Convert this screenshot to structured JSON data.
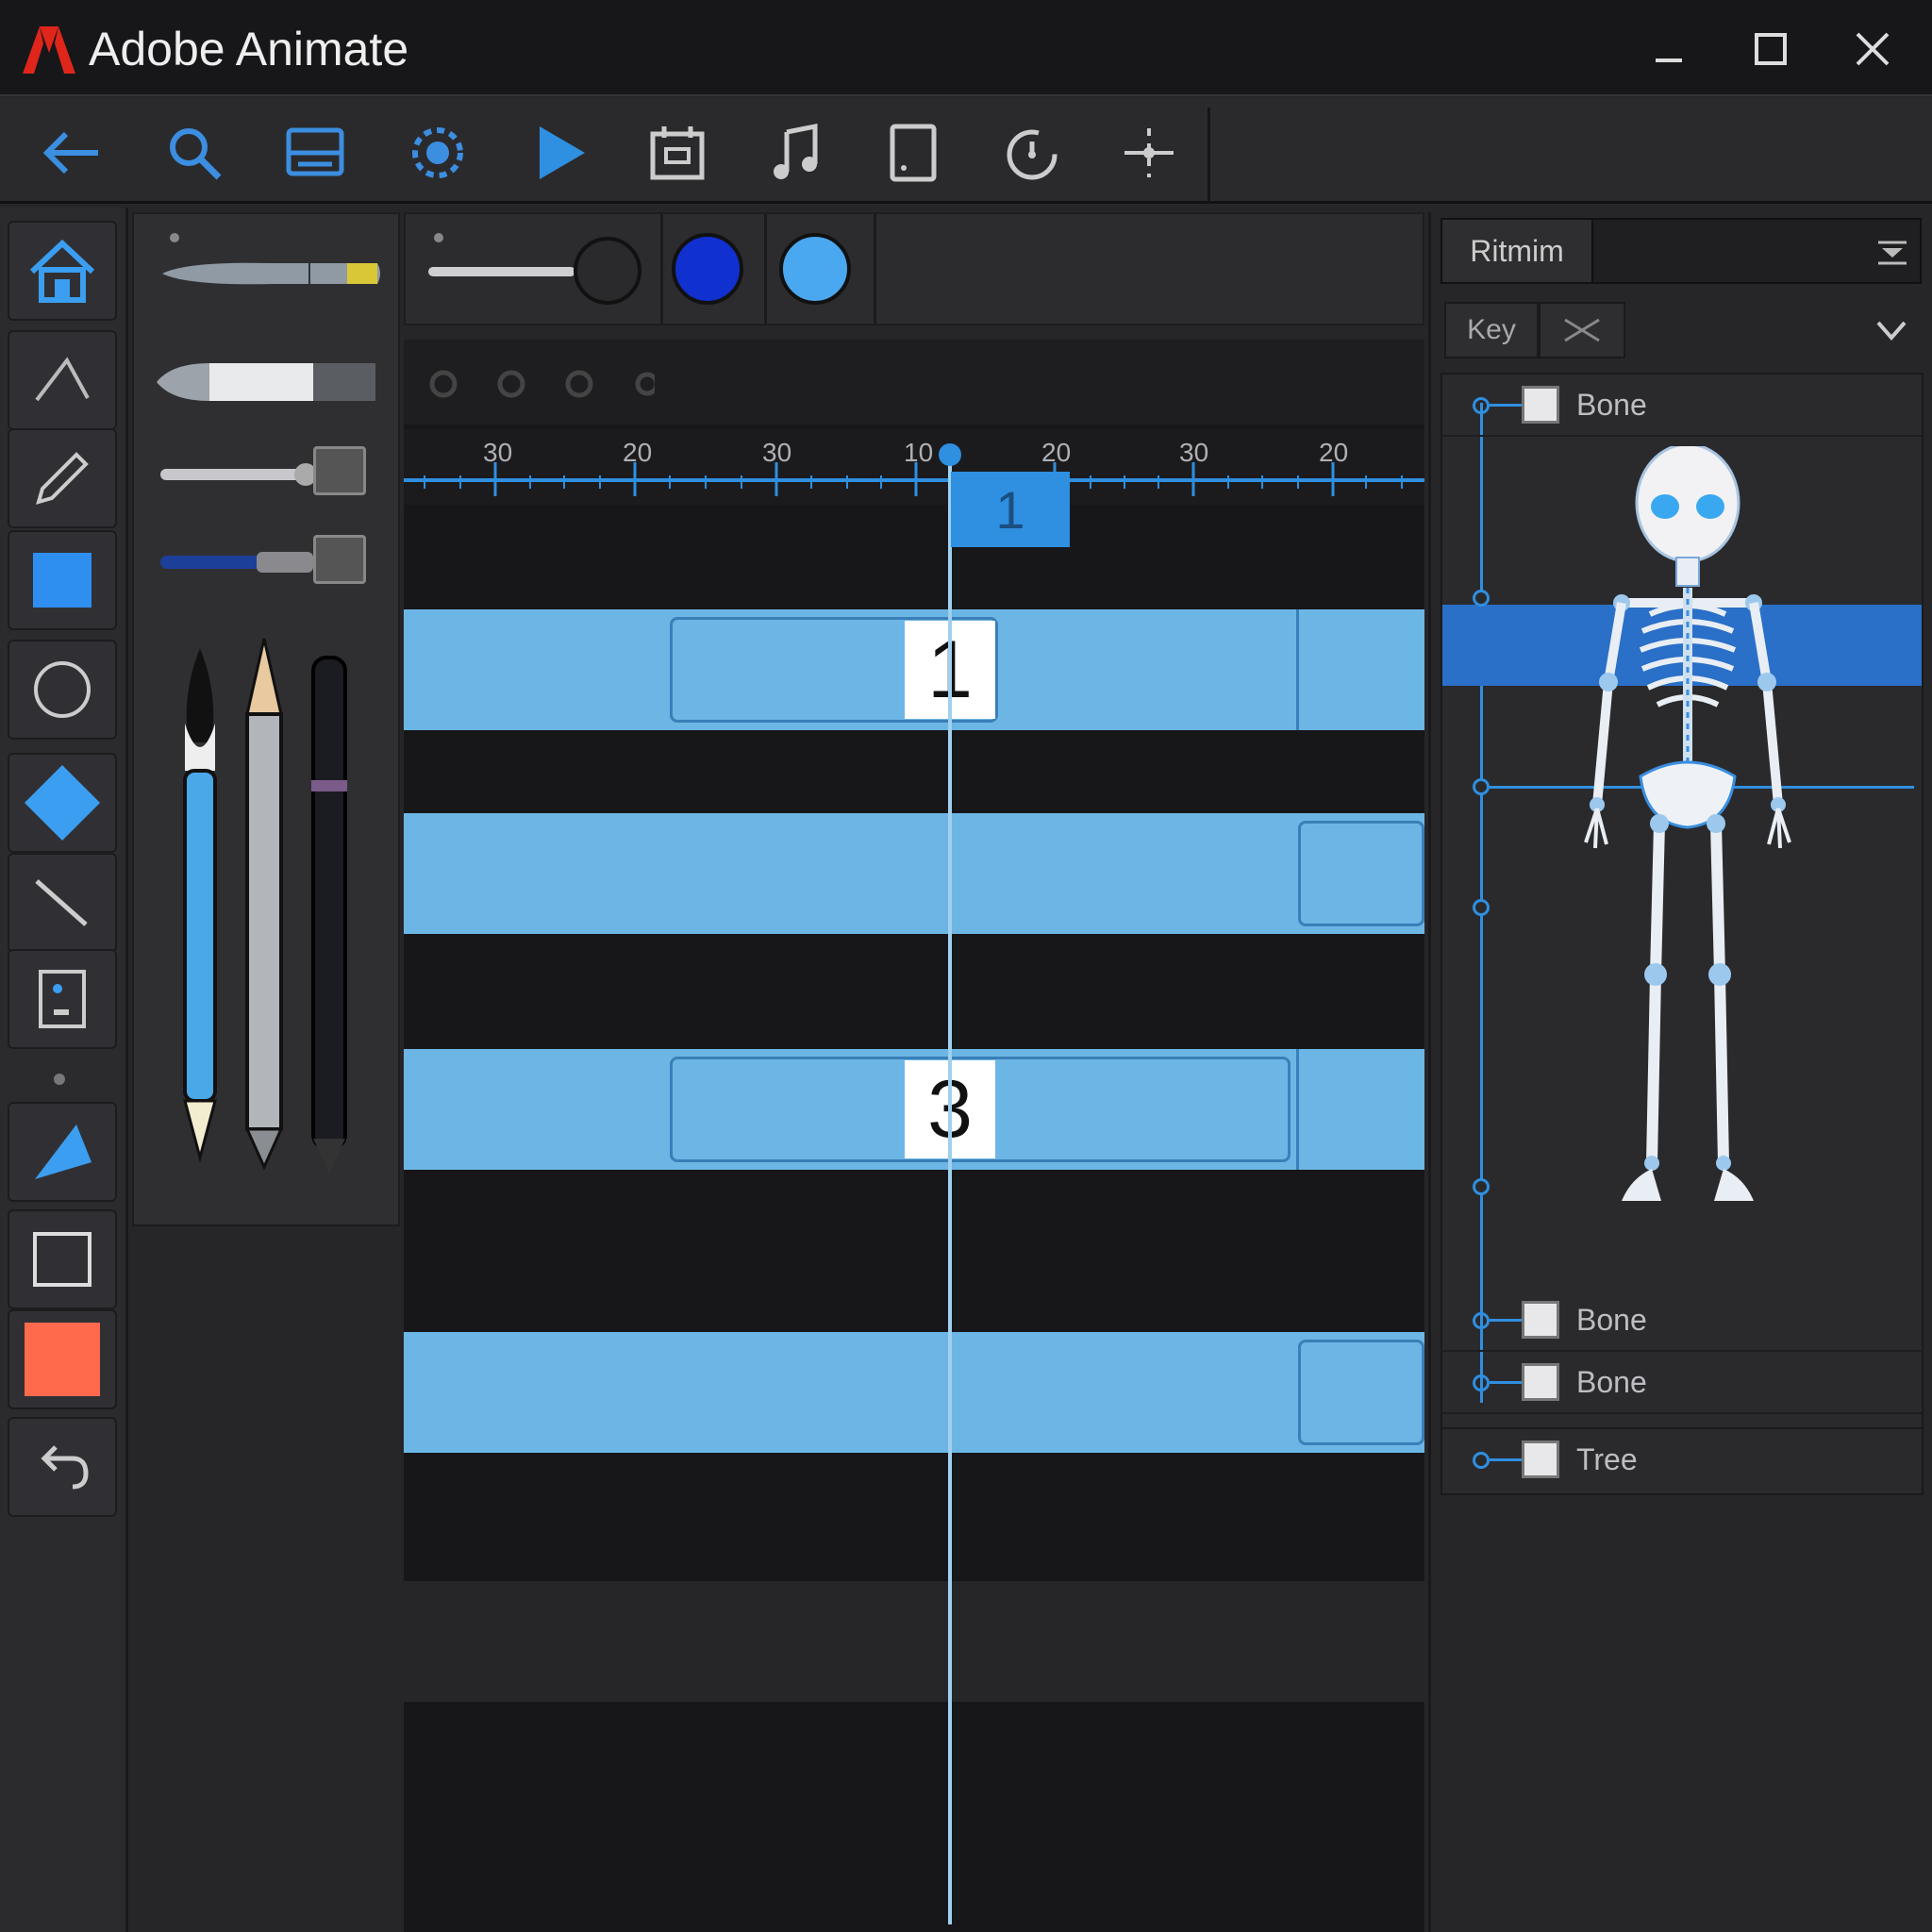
{
  "window": {
    "title": "Adobe Animate",
    "logo_color": "#e0251b",
    "accent": "#2f8fe0"
  },
  "toolbar": {
    "buttons": [
      "back-arrow-icon",
      "search-icon",
      "layout-icon",
      "gear-icon",
      "play-icon",
      "calendar-icon",
      "music-icon",
      "tablet-icon",
      "timer-icon",
      "move-icon"
    ]
  },
  "tools": [
    "home-icon",
    "line-icon",
    "pencil-icon",
    "rectangle-tool-icon",
    "ellipse-icon",
    "diamond-icon",
    "diagonal-line-icon",
    "frame-icon",
    "pen-icon",
    "rectangle-outline-icon",
    "fill-color-swatch",
    "undo-icon"
  ],
  "colors": {
    "fill_swatch": "#ff6a4d",
    "stroke_dark_blue": "#1030d0",
    "stroke_light_blue": "#4aa8f0"
  },
  "timeline": {
    "ruler_labels": [
      "30",
      "20",
      "30",
      "10",
      "20",
      "30",
      "20"
    ],
    "playhead_frame": "1",
    "clips": [
      {
        "label": "1"
      },
      {
        "label": "3"
      }
    ]
  },
  "right_panel": {
    "tab_label": "Ritmim",
    "sub_label": "Key",
    "tree_items": [
      {
        "label": "Bone"
      },
      {
        "label": "Bone"
      },
      {
        "label": "Bone"
      },
      {
        "label": "Tree"
      }
    ]
  }
}
